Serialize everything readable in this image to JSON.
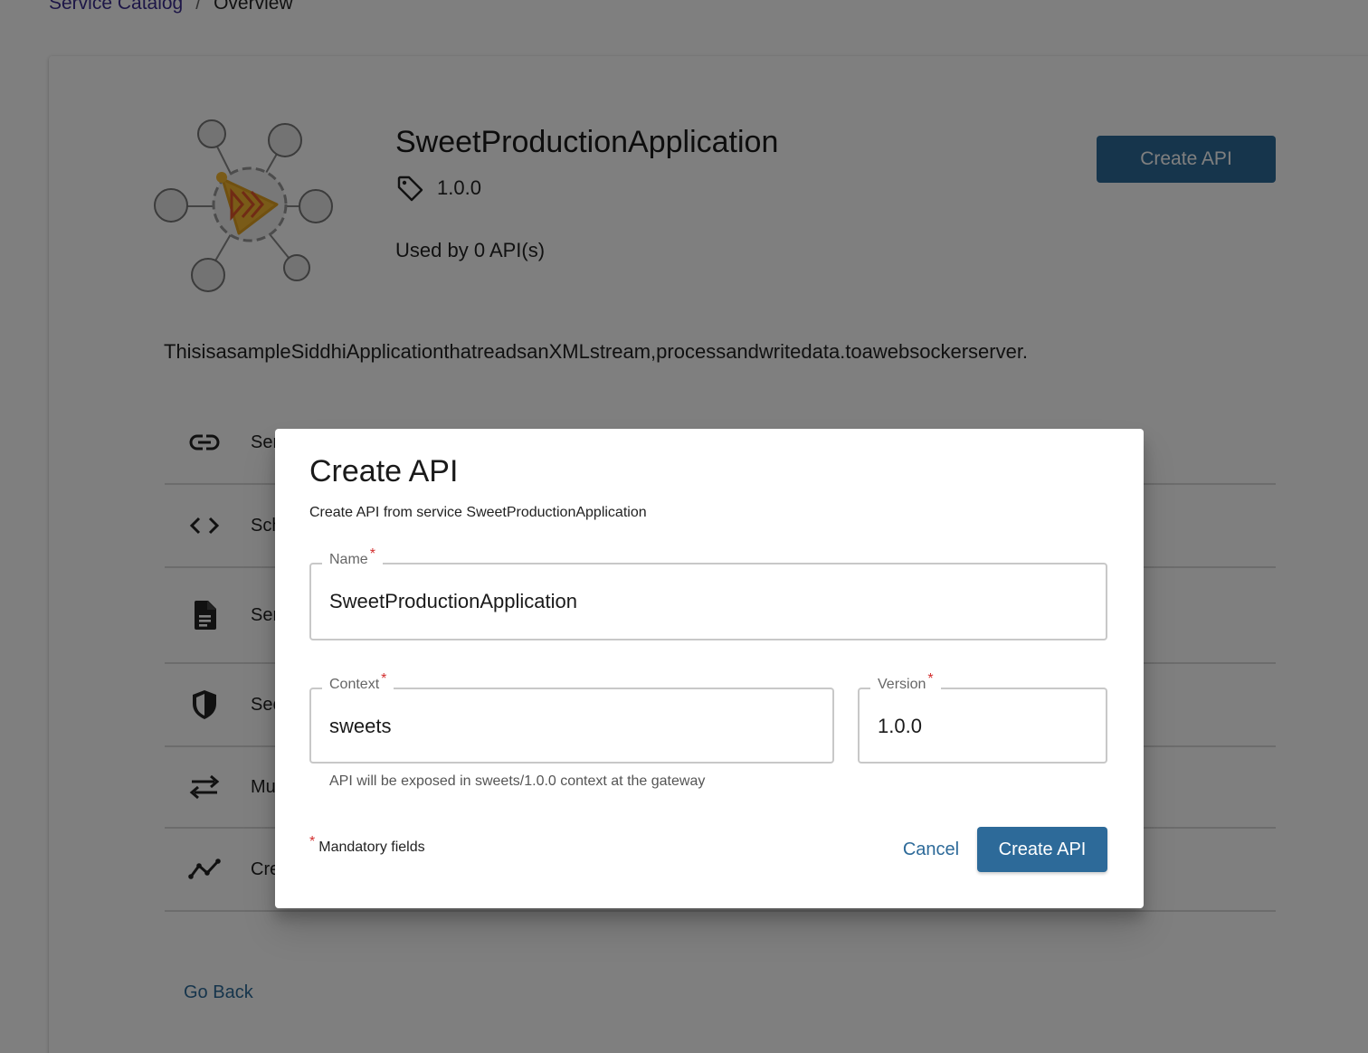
{
  "breadcrumb": {
    "root": "Service Catalog",
    "separator": "/",
    "current": "Overview"
  },
  "service": {
    "name": "SweetProductionApplication",
    "version": "1.0.0",
    "usage": "Used by 0 API(s)",
    "description": "ThisisasampleSiddhiApplicationthatreadsanXMLstream,processandwritedata.toawebsockerserver.",
    "create_api_label": "Create API",
    "logo_icon": "siddhi-service-icon"
  },
  "info_rows": [
    {
      "icon": "link-icon",
      "label": "Ser"
    },
    {
      "icon": "code-icon",
      "label": "Sch"
    },
    {
      "icon": "document-icon",
      "label": "Ser"
    },
    {
      "icon": "shield-icon",
      "label": "Sec"
    },
    {
      "icon": "swap-icon",
      "label": "Mu"
    },
    {
      "icon": "timeline-icon",
      "label": "Cre"
    }
  ],
  "go_back": "Go Back",
  "dialog": {
    "title": "Create API",
    "subtitle": "Create API from service SweetProductionApplication",
    "name_label": "Name",
    "name_value": "SweetProductionApplication",
    "context_label": "Context",
    "context_value": "sweets",
    "version_label": "Version",
    "version_value": "1.0.0",
    "required_marker": "*",
    "helper_text": "API will be exposed in sweets/1.0.0 context at the gateway",
    "mandatory_text": "Mandatory fields",
    "cancel_label": "Cancel",
    "create_label": "Create API"
  },
  "colors": {
    "primary": "#2d6a99",
    "required": "#d32f2f",
    "breadcrumb_link": "#3b2c8f",
    "logo_accent": "#f5b731"
  }
}
